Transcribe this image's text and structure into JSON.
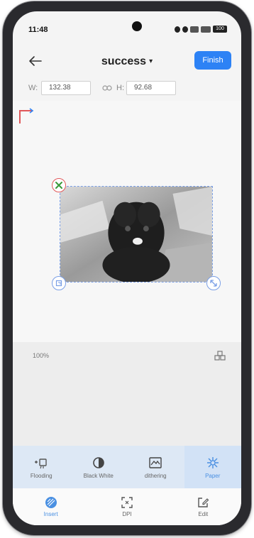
{
  "status_bar": {
    "time": "11:48",
    "battery": "100"
  },
  "header": {
    "title": "success",
    "finish_label": "Finish"
  },
  "size": {
    "width_label": "W:",
    "width_value": "132.38",
    "height_label": "H:",
    "height_value": "92.68"
  },
  "canvas": {
    "zoom_label": "100%"
  },
  "tools": [
    {
      "label": "Flooding",
      "icon": "flooding-icon"
    },
    {
      "label": "Black White",
      "icon": "contrast-icon"
    },
    {
      "label": "dithering",
      "icon": "dithering-icon"
    },
    {
      "label": "Paper",
      "icon": "paper-icon"
    }
  ],
  "nav": [
    {
      "label": "Insert",
      "icon": "insert-icon"
    },
    {
      "label": "DPI",
      "icon": "dpi-icon"
    },
    {
      "label": "Edit",
      "icon": "edit-icon"
    }
  ],
  "colors": {
    "accent": "#2d82f5",
    "toolbar_bg": "#dde8f5",
    "delete_handle": "#e0585a"
  }
}
